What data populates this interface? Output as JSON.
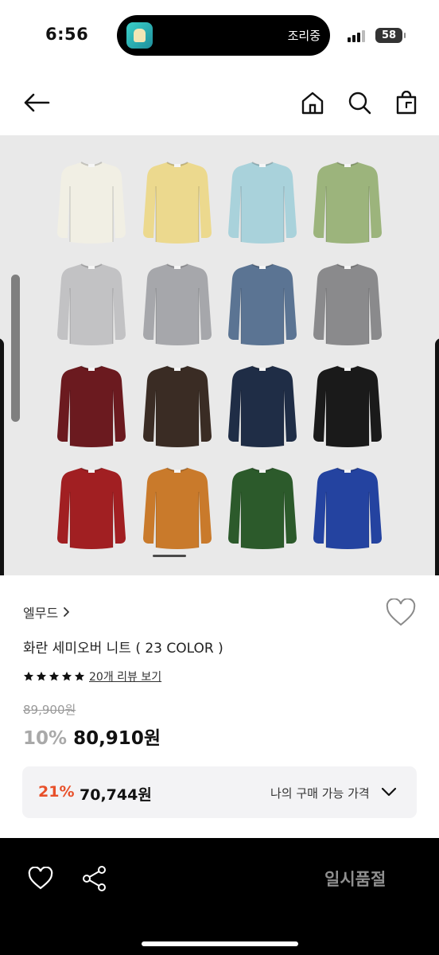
{
  "status_bar": {
    "time": "6:56",
    "live_activity_text": "조리중",
    "battery": "58"
  },
  "header": {
    "icons": [
      "arrow-left-icon",
      "home-icon",
      "search-icon",
      "shopping-bag-icon"
    ]
  },
  "product_image": {
    "colors": [
      "#f1efe4",
      "#ecd98e",
      "#a9d2db",
      "#9cb47c",
      "#c2c2c4",
      "#a6a7ab",
      "#5b7493",
      "#8a8a8c",
      "#6b1a1f",
      "#3a2c24",
      "#1f2d46",
      "#1a1a1a",
      "#a11f22",
      "#c97a2b",
      "#2c5a2b",
      "#2443a0"
    ]
  },
  "product": {
    "brand": "엘무드",
    "title": "화란 세미오버 니트 ( 23 COLOR )",
    "rating": 5,
    "review_link": "20개 리뷰 보기",
    "original_price": "89,900원",
    "discount_rate": "10%",
    "sale_price": "80,910원"
  },
  "my_price": {
    "rate": "21%",
    "price": "70,744원",
    "label": "나의 구매 가능 가격"
  },
  "bottom_bar": {
    "status": "일시품절"
  },
  "theme": {
    "accent": "#e8502a",
    "bar_background": "#000000"
  }
}
